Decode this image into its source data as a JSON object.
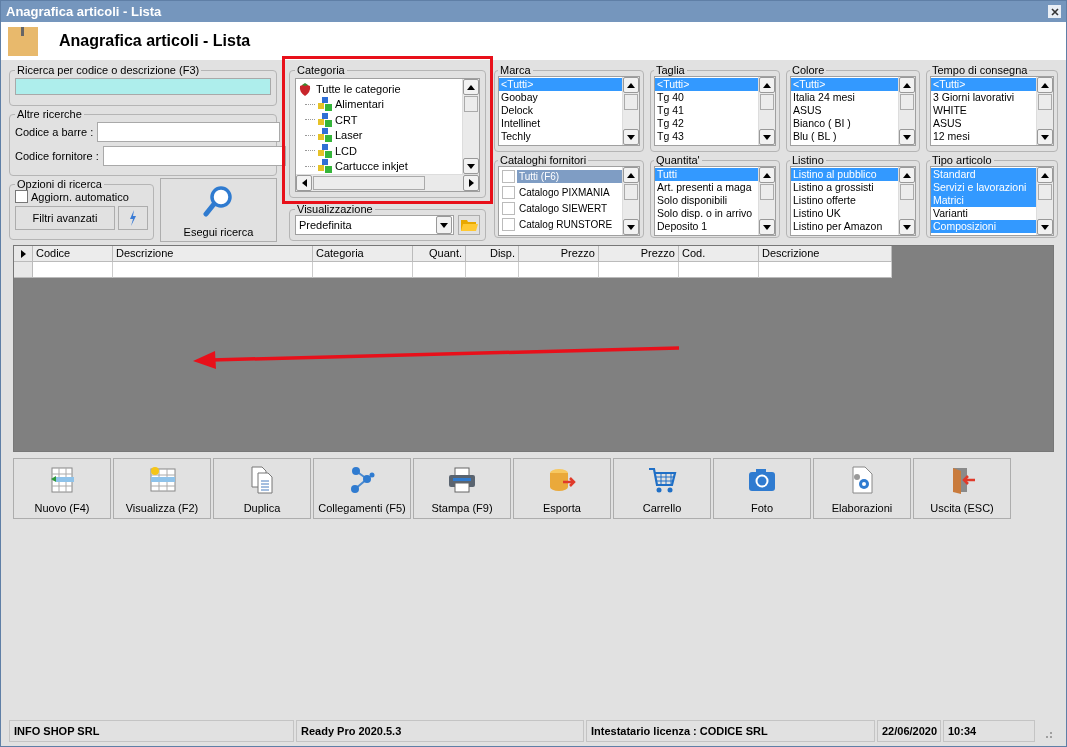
{
  "window": {
    "title": "Anagrafica articoli  - Lista"
  },
  "header": {
    "title": "Anagrafica articoli  - Lista"
  },
  "search": {
    "label": "Ricerca per codice o descrizione (F3)"
  },
  "other_searches": {
    "title": "Altre ricerche",
    "fields": [
      {
        "label": "Codice a barre :"
      },
      {
        "label": "Codice fornitore :"
      }
    ]
  },
  "options": {
    "title": "Opzioni di ricerca",
    "auto_update": {
      "label": "Aggiorn. automatico",
      "checked": false
    },
    "advanced_button": "Filtri avanzati"
  },
  "search_button": "Esegui ricerca",
  "category": {
    "title": "Categoria",
    "highlighted": true,
    "tree": {
      "label": "Tutte le categorie",
      "children": [
        {
          "label": "Alimentari"
        },
        {
          "label": "CRT"
        },
        {
          "label": "Laser"
        },
        {
          "label": "LCD"
        },
        {
          "label": "Cartucce inkjet"
        }
      ]
    }
  },
  "view": {
    "title": "Visualizzazione",
    "value": "Predefinita"
  },
  "filters": [
    {
      "title": "Marca",
      "kind": "list",
      "items": [
        {
          "label": "<Tutti>",
          "selected": true
        },
        {
          "label": "Goobay",
          "selected": false
        },
        {
          "label": "Delock",
          "selected": false
        },
        {
          "label": "Intellinet",
          "selected": false
        },
        {
          "label": "Techly",
          "selected": false
        }
      ]
    },
    {
      "title": "Taglia",
      "kind": "list",
      "items": [
        {
          "label": "<Tutti>",
          "selected": true
        },
        {
          "label": "Tg 40",
          "selected": false
        },
        {
          "label": "Tg 41",
          "selected": false
        },
        {
          "label": "Tg 42",
          "selected": false
        },
        {
          "label": "Tg 43",
          "selected": false
        }
      ]
    },
    {
      "title": "Colore",
      "kind": "list",
      "items": [
        {
          "label": "<Tutti>",
          "selected": true
        },
        {
          "label": "Italia 24 mesi",
          "selected": false
        },
        {
          "label": "ASUS",
          "selected": false
        },
        {
          "label": "Bianco ( BI )",
          "selected": false
        },
        {
          "label": "Blu ( BL )",
          "selected": false
        }
      ]
    },
    {
      "title": "Tempo di consegna",
      "kind": "list",
      "items": [
        {
          "label": "<Tutti>",
          "selected": true
        },
        {
          "label": "3 Giorni lavorativi",
          "selected": false
        },
        {
          "label": "WHITE",
          "selected": false
        },
        {
          "label": "ASUS",
          "selected": false
        },
        {
          "label": "12 mesi",
          "selected": false
        }
      ]
    },
    {
      "title": "Cataloghi fornitori",
      "kind": "checklist",
      "items": [
        {
          "label": "Tutti (F6)",
          "selected": true,
          "checked": false
        },
        {
          "label": "Catalogo PIXMANIA",
          "selected": false,
          "checked": false
        },
        {
          "label": "Catalogo SIEWERT",
          "selected": false,
          "checked": false
        },
        {
          "label": "Catalog RUNSTORE",
          "selected": false,
          "checked": false
        }
      ]
    },
    {
      "title": "Quantita'",
      "kind": "list",
      "items": [
        {
          "label": "Tutti",
          "selected": true
        },
        {
          "label": "Art. presenti a maga",
          "selected": false
        },
        {
          "label": "Solo disponibili",
          "selected": false
        },
        {
          "label": "Solo disp. o in arrivo",
          "selected": false
        },
        {
          "label": "Deposito 1",
          "selected": false
        }
      ]
    },
    {
      "title": "Listino",
      "kind": "list",
      "items": [
        {
          "label": "Listino al pubblico",
          "selected": true
        },
        {
          "label": "Listino a grossisti",
          "selected": false
        },
        {
          "label": "Listino offerte",
          "selected": false
        },
        {
          "label": "Listino UK",
          "selected": false
        },
        {
          "label": "Listino per Amazon",
          "selected": false
        }
      ]
    },
    {
      "title": "Tipo articolo",
      "kind": "list",
      "items": [
        {
          "label": "Standard",
          "selected": true
        },
        {
          "label": "Servizi e lavorazioni",
          "selected": true
        },
        {
          "label": "Matrici",
          "selected": true
        },
        {
          "label": "Varianti",
          "selected": false
        },
        {
          "label": "Composizioni",
          "selected": true
        }
      ]
    }
  ],
  "grid": {
    "columns": [
      {
        "label": "Codice",
        "kind": "text"
      },
      {
        "label": "Descrizione",
        "kind": "text"
      },
      {
        "label": "Categoria",
        "kind": "text"
      },
      {
        "label": "Quant.",
        "kind": "number"
      },
      {
        "label": "Disp.",
        "kind": "number"
      },
      {
        "label": "Prezzo",
        "kind": "number"
      },
      {
        "label": "Prezzo",
        "kind": "number"
      },
      {
        "label": "Cod.",
        "kind": "text"
      },
      {
        "label": "Descrizione",
        "kind": "text"
      }
    ]
  },
  "toolbar": [
    {
      "label": "Nuovo (F4)",
      "kind": "new"
    },
    {
      "label": "Visualizza (F2)",
      "kind": "view"
    },
    {
      "label": "Duplica",
      "kind": "duplicate"
    },
    {
      "label": "Collegamenti (F5)",
      "kind": "links"
    },
    {
      "label": "Stampa (F9)",
      "kind": "print"
    },
    {
      "label": "Esporta",
      "kind": "export"
    },
    {
      "label": "Carrello",
      "kind": "cart"
    },
    {
      "label": "Foto",
      "kind": "photo"
    },
    {
      "label": "Elaborazioni",
      "kind": "process"
    },
    {
      "label": "Uscita (ESC)",
      "kind": "exit"
    }
  ],
  "status_bar": [
    "INFO SHOP SRL",
    "Ready Pro 2020.5.3",
    "Intestatario licenza : CODICE SRL",
    "22/06/2020",
    "10:34"
  ]
}
